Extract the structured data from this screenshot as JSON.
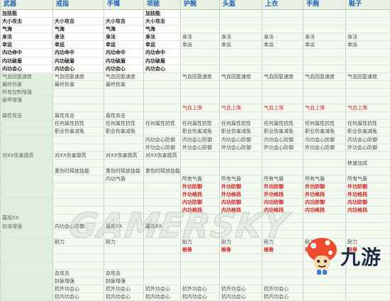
{
  "headers": [
    "武器",
    "戒指",
    "手镯",
    "项链",
    "护腕",
    "头盔",
    "上衣",
    "手腕",
    "鞋子"
  ],
  "rows": [
    [
      "加技能",
      "",
      "",
      "加技能",
      "",
      "",
      "",
      "",
      ""
    ],
    [
      "大小攻击",
      "大小攻击",
      "大小攻击",
      "大小攻击",
      "",
      "",
      "",
      "",
      ""
    ],
    [
      "气海",
      "气海",
      "气海",
      "气海",
      "",
      "",
      "",
      "",
      ""
    ],
    [
      "身法",
      "身法",
      "身法",
      "身法",
      "身法",
      "身法",
      "身法",
      "身法",
      "身法"
    ],
    [
      "幸运",
      "幸运",
      "幸运",
      "幸运",
      "幸运",
      "幸运",
      "幸运",
      "幸运",
      "幸运"
    ],
    [
      "内功命中",
      "内功命中",
      "内功命中",
      "内功命中",
      "",
      "",
      "",
      "",
      ""
    ],
    [
      "内功破盾",
      "内功破盾",
      "内功破盾",
      "内功破盾",
      "",
      "",
      "",
      "",
      ""
    ],
    [
      "内功会心",
      "内功会心",
      "内功会心",
      "内功会心",
      "",
      "",
      "",
      "",
      ""
    ],
    [
      "气血回复速度",
      "气血回复速度",
      "气血回复速度",
      "",
      "气血回复速度",
      "气血回复速度",
      "气血回复速度",
      "气血回复速度",
      "气血回复速度"
    ],
    [
      "最终伤害",
      "最终伤害",
      "最终伤害",
      "",
      "",
      "",
      "",
      "",
      ""
    ],
    [
      "所有控制增强",
      "",
      "",
      "",
      "",
      "",
      "",
      "",
      ""
    ],
    [
      "破甲增强",
      "",
      "",
      "",
      "",
      "",
      "",
      "",
      ""
    ],
    [
      "",
      "",
      "",
      "",
      "气血上限",
      "气血上限",
      "气血上限",
      "气血上限",
      "气血上限"
    ],
    [
      "属性攻击",
      "属性攻击",
      "属性攻击",
      "",
      "",
      "",
      "",
      "",
      ""
    ],
    [
      "",
      "任何属性抗性",
      "任何属性抗性",
      "任何属性抗性",
      "任何属性抗性",
      "任何属性抗性",
      "任何属性抗性",
      "任何属性抗性",
      "任何属性抗性"
    ],
    [
      "",
      "职业伤害减免",
      "职业伤害减免",
      "",
      "职业伤害减免",
      "职业伤害减免",
      "职业伤害减免",
      "职业伤害减免",
      "职业伤害减免"
    ],
    [
      "",
      "",
      "",
      "内功会心防御",
      "内功会心防御",
      "内功会心防御",
      "内功会心防御",
      "内功会心防御",
      "内功会心防御"
    ],
    [
      "",
      "",
      "",
      "外功会心防御",
      "外功会心防御",
      "外功会心防御",
      "外功会心防御",
      "外功会心防御",
      "外功会心防御"
    ],
    [
      "对XX伤害提高",
      "对XX伤害提高",
      "对XX伤害提高",
      "对XX伤害提高",
      "",
      "",
      "",
      "",
      ""
    ],
    [
      "",
      "",
      "",
      "",
      "",
      "",
      "",
      "",
      "移速加成"
    ],
    [
      "",
      "重伤时释放技能",
      "重伤时释放技能",
      "重伤时释放技能",
      "",
      "",
      "",
      "",
      ""
    ],
    [
      "",
      "",
      "内功气盾",
      "",
      "所有气盾",
      "所有气盾",
      "所有气盾",
      "所有气盾",
      "所有气盾"
    ],
    [
      "",
      "",
      "",
      "",
      "外功防御",
      "外功防御",
      "外功防御",
      "外功防御",
      "外功防御"
    ],
    [
      "",
      "",
      "",
      "",
      "外功格挡",
      "外功格挡",
      "外功格挡",
      "外功格挡",
      "外功格挡"
    ],
    [
      "",
      "",
      "",
      "",
      "内功防御",
      "内功防御",
      "内功防御",
      "内功防御",
      "内功防御"
    ],
    [
      "",
      "",
      "",
      "",
      "内功格挡",
      "内功格挡",
      "内功格挡",
      "内功格挡",
      "内功格挡"
    ],
    [
      "蔑视XX",
      "",
      "",
      "",
      "",
      "",
      "",
      "",
      ""
    ],
    [
      "仅诛增强",
      "内功会心防御",
      "蔑视XX",
      "蔑视XX",
      "",
      "",
      "",
      "",
      ""
    ],
    [
      "",
      "",
      "",
      "",
      "",
      "",
      "",
      "",
      ""
    ],
    [
      "",
      "耐力",
      "耐力",
      "",
      "耐力",
      "耐力",
      "耐力",
      "耐力",
      "耐力"
    ],
    [
      "",
      "",
      "",
      "",
      "根骨",
      "根骨",
      "根骨",
      "根骨",
      "根骨"
    ],
    [
      "",
      "",
      "",
      "",
      "",
      "",
      "",
      "",
      ""
    ],
    [
      "",
      "",
      "",
      "",
      "",
      "",
      "",
      "",
      ""
    ],
    [
      "",
      "血攻击",
      "血攻击",
      "",
      "",
      "",
      "",
      "",
      ""
    ],
    [
      "",
      "封脉增强",
      "封脉增强",
      "",
      "",
      "",
      "",
      "",
      ""
    ],
    [
      "",
      "抗外功会心",
      "抗外功会心",
      "抗外功会心",
      "抗外功会心",
      "抗外功会心",
      "抗外功会心",
      "",
      ""
    ],
    [
      "",
      "抗内功会心",
      "抗内功会心",
      "抗内功会心",
      "抗内功会心",
      "抗内功会心",
      "抗内功会心",
      "",
      ""
    ]
  ],
  "watermark": "GAMERSKY",
  "logo": {
    "icon": "mushroom-mascot-icon",
    "text": "九游",
    "color": "#1f2a44"
  },
  "colors": {
    "header_text": "#1f62b4",
    "highlight_red": "#d42a2a",
    "sheet_bg": "#eef6ea"
  }
}
